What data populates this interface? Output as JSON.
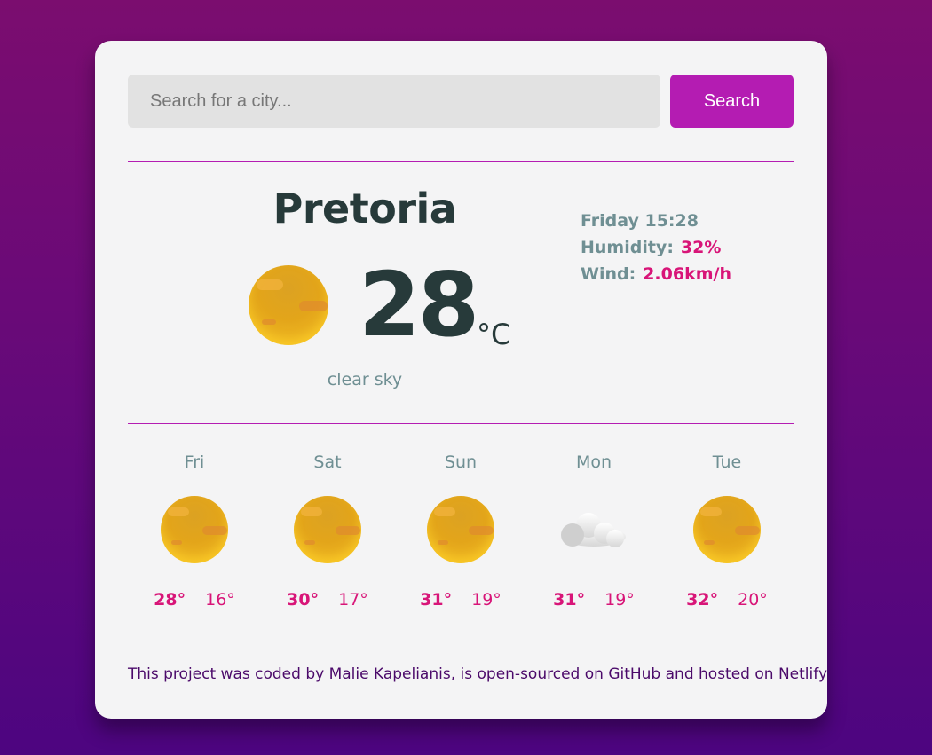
{
  "search": {
    "placeholder": "Search for a city...",
    "value": "",
    "button_label": "Search"
  },
  "current": {
    "city": "Pretoria",
    "icon": "sun-icon",
    "temperature": "28",
    "unit": "°C",
    "description": "clear sky",
    "datetime": "Friday 15:28",
    "humidity_label": "Humidity:",
    "humidity_value": "32%",
    "wind_label": "Wind:",
    "wind_value": "2.06km/h"
  },
  "forecast": [
    {
      "day": "Fri",
      "icon": "sun-icon",
      "max": "28°",
      "min": "16°"
    },
    {
      "day": "Sat",
      "icon": "sun-icon",
      "max": "30°",
      "min": "17°"
    },
    {
      "day": "Sun",
      "icon": "sun-icon",
      "max": "31°",
      "min": "19°"
    },
    {
      "day": "Mon",
      "icon": "cloud-icon",
      "max": "31°",
      "min": "19°"
    },
    {
      "day": "Tue",
      "icon": "sun-icon",
      "max": "32°",
      "min": "20°"
    }
  ],
  "footer": {
    "text_1": "This project was coded by ",
    "author_link": "Malie Kapelianis",
    "text_2": ", is open-sourced on ",
    "github_link": "GitHub",
    "text_3": " and hosted on ",
    "netlify_link": "Netlify"
  },
  "colors": {
    "accent": "#b41cb2",
    "value_pink": "#d81578",
    "muted_teal": "#6f8f93",
    "dark_text": "#273a3a",
    "footer_text": "#4b0a6a"
  }
}
